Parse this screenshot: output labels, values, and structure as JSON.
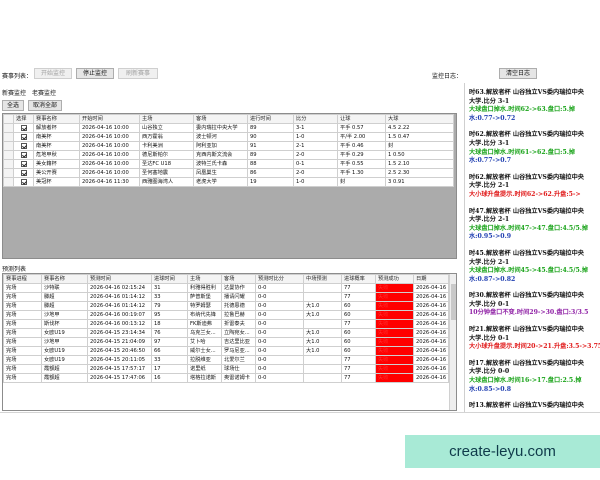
{
  "toolbar": {
    "event_list_label": "赛事列表：",
    "start_label": "开始监控",
    "stop_label": "停止监控",
    "refresh_label": "刷新赛事",
    "monitor_log_label": "监控日志：",
    "clear_log_label": "清空日志"
  },
  "new_monitor": {
    "title": "新赛监控",
    "sub_title": "老赛监控",
    "select_all": "全选",
    "deselect_all": "取消全部",
    "columns": [
      "选择",
      "赛事名称",
      "开始时间",
      "主场",
      "客场",
      "进行时间",
      "比分",
      "让球",
      "大球"
    ],
    "rows": [
      [
        "解放者杯",
        "2026-04-16 10:00",
        "山谷独立",
        "委内瑞拉中央大学",
        "89",
        "3-1",
        "平手 0.57",
        "4.5 2.22"
      ],
      [
        "南美杯",
        "2026-04-16 10:00",
        "西万霍翁",
        "波士顿河",
        "90",
        "1-0",
        "平/半 2.00",
        "1.5 0.47"
      ],
      [
        "南美杯",
        "2026-04-16 10:00",
        "卡利美洲",
        "阿利亚加",
        "91",
        "2-1",
        "平手 0.46",
        "封"
      ],
      [
        "危地甲秋",
        "2026-04-16 10:00",
        "德尼斯帕尔",
        "克西内斯文流会",
        "89",
        "2-0",
        "平手 0.29",
        "1 0.50"
      ],
      [
        "美女籍杯",
        "2026-04-16 10:00",
        "圣达FC U18",
        "波特兰氏卡森",
        "88",
        "0-1",
        "平手 0.55",
        "1.5 2.10"
      ],
      [
        "美公开赛",
        "2026-04-16 10:00",
        "圣何塞地震",
        "凤凰巢生",
        "86",
        "2-0",
        "平手 1.30",
        "2.5 2.30"
      ],
      [
        "美冠杯",
        "2026-04-16 11:30",
        "西雅图海湾人",
        "老虎大学",
        "19",
        "1-0",
        "封",
        "3 0.91"
      ]
    ]
  },
  "predictions": {
    "title": "预测列表",
    "columns": [
      "赛事进程",
      "赛事名称",
      "预测时间",
      "进球时间",
      "主场",
      "客场",
      "预测时比分",
      "中场预测",
      "进球概率",
      "预测成功",
      "日期"
    ],
    "rows": [
      [
        "完场",
        "沙特联",
        "2026-04-16 02:15:24",
        "31",
        "利雅得胜利",
        "达曼协作",
        "0-0",
        "",
        "77",
        "失败",
        "2026-04-16"
      ],
      [
        "完场",
        "滕超",
        "2026-04-16 01:14:12",
        "33",
        "萨普斯堡",
        "播请闪耀",
        "0-0",
        "",
        "77",
        "失败",
        "2026-04-16"
      ],
      [
        "完场",
        "滕超",
        "2026-04-16 01:14:12",
        "79",
        "特罗姆瑟",
        "托德恩德",
        "0-0",
        "大1.0",
        "60",
        "失败",
        "2026-04-16"
      ],
      [
        "完场",
        "沙地甲",
        "2026-04-16 00:19:07",
        "95",
        "布纳代先锋",
        "拉鲁巴赫",
        "0-0",
        "大1.0",
        "60",
        "失败",
        "2026-04-16"
      ],
      [
        "完场",
        "斯伐杯",
        "2026-04-16 00:13:12",
        "18",
        "FK斯迪弗",
        "折雷泰夫",
        "0-0",
        "",
        "77",
        "失败",
        "2026-04-16"
      ],
      [
        "完场",
        "女欧U19",
        "2026-04-15 23:14:34",
        "76",
        "乌克兰女...",
        "立陶宛女...",
        "0-0",
        "大1.0",
        "60",
        "失败",
        "2026-04-16"
      ],
      [
        "完场",
        "沙地甲",
        "2026-04-15 21:04:09",
        "97",
        "艾卜哈",
        "吉达里比亚",
        "0-0",
        "大1.0",
        "60",
        "失败",
        "2026-04-16"
      ],
      [
        "完场",
        "女欧U19",
        "2026-04-15 20:46:50",
        "66",
        "威尔士女...",
        "罗马尼亚...",
        "0-0",
        "大1.0",
        "60",
        "失败",
        "2026-04-16"
      ],
      [
        "完场",
        "女欧U19",
        "2026-04-15 20:11:05",
        "33",
        "拉脱维亚",
        "北爱尔兰",
        "0-0",
        "",
        "77",
        "失败",
        "2026-04-16"
      ],
      [
        "完场",
        "霞额超",
        "2026-04-15 17:57:17",
        "17",
        "诺里纸",
        "球场仕",
        "0-0",
        "",
        "77",
        "失败",
        "2026-04-16"
      ],
      [
        "完场",
        "霞额超",
        "2026-04-15 17:47:06",
        "16",
        "塔格拉诺斯",
        "奥雷诺姆卡",
        "0-0",
        "",
        "77",
        "失败",
        "2026-04-16"
      ]
    ]
  },
  "log": [
    {
      "lines": [
        {
          "text": "时63.解放者杯 山谷独立VS委内瑞拉中央",
          "color": "black"
        },
        {
          "text": "大学.比分 3-1",
          "color": "black"
        },
        {
          "text": "大球盘口掉水.时间62->63.盘口:5.掉",
          "color": "green"
        },
        {
          "text": "水:0.77->0.72",
          "color": "blue"
        }
      ]
    },
    {
      "lines": [
        {
          "text": "时62.解放者杯 山谷独立VS委内瑞拉中央",
          "color": "black"
        },
        {
          "text": "大学.比分 3-1",
          "color": "black"
        },
        {
          "text": "大球盘口掉水.时间61->62.盘口:5.掉",
          "color": "green"
        },
        {
          "text": "水:0.77->0.7",
          "color": "blue"
        }
      ]
    },
    {
      "lines": [
        {
          "text": "时62.解放者杯 山谷独立VS委内瑞拉中央",
          "color": "black"
        },
        {
          "text": "大学.比分 2-1",
          "color": "black"
        },
        {
          "text": "大小球升盘提示.时间62->62.升盘:5->",
          "color": "red"
        }
      ]
    },
    {
      "lines": [
        {
          "text": "时47.解放者杯 山谷独立VS委内瑞拉中央",
          "color": "black"
        },
        {
          "text": "大学.比分 2-1",
          "color": "black"
        },
        {
          "text": "大球盘口掉水.时间47->47.盘口:4.5/5.掉",
          "color": "green"
        },
        {
          "text": "水:0.95->0.9",
          "color": "blue"
        }
      ]
    },
    {
      "lines": [
        {
          "text": "时45.解放者杯 山谷独立VS委内瑞拉中央",
          "color": "black"
        },
        {
          "text": "大学.比分 2-1",
          "color": "black"
        },
        {
          "text": "大球盘口掉水.时间45->45.盘口:4.5/5.掉",
          "color": "green"
        },
        {
          "text": "水:0.87->0.82",
          "color": "blue"
        }
      ]
    },
    {
      "lines": [
        {
          "text": "时30.解放者杯 山谷独立VS委内瑞拉中央",
          "color": "black"
        },
        {
          "text": "大学.比分 0-1",
          "color": "black"
        },
        {
          "text": "10分钟盘口不变.时间29->30.盘口:3/3.5",
          "color": "purple"
        }
      ]
    },
    {
      "lines": [
        {
          "text": "时21.解放者杯 山谷独立VS委内瑞拉中央",
          "color": "black"
        },
        {
          "text": "大学.比分 0-1",
          "color": "black"
        },
        {
          "text": "大小球升盘提示.时间20->21.升盘:3.5->3.75",
          "color": "red"
        }
      ]
    },
    {
      "lines": [
        {
          "text": "时17.解放者杯 山谷独立VS委内瑞拉中央",
          "color": "black"
        },
        {
          "text": "大学.比分 0-0",
          "color": "black"
        },
        {
          "text": "大球盘口掉水.时间16->17.盘口:2.5.掉",
          "color": "green"
        },
        {
          "text": "水:0.85->0.8",
          "color": "blue"
        }
      ]
    },
    {
      "lines": [
        {
          "text": "时13.解放者杯 山谷独立VS委内瑞拉中央",
          "color": "black"
        }
      ]
    }
  ],
  "banner": {
    "text": "create-leyu.com"
  },
  "colors": {
    "fail_cell": "#ff0000",
    "banner_bg": "#a8ead6"
  }
}
